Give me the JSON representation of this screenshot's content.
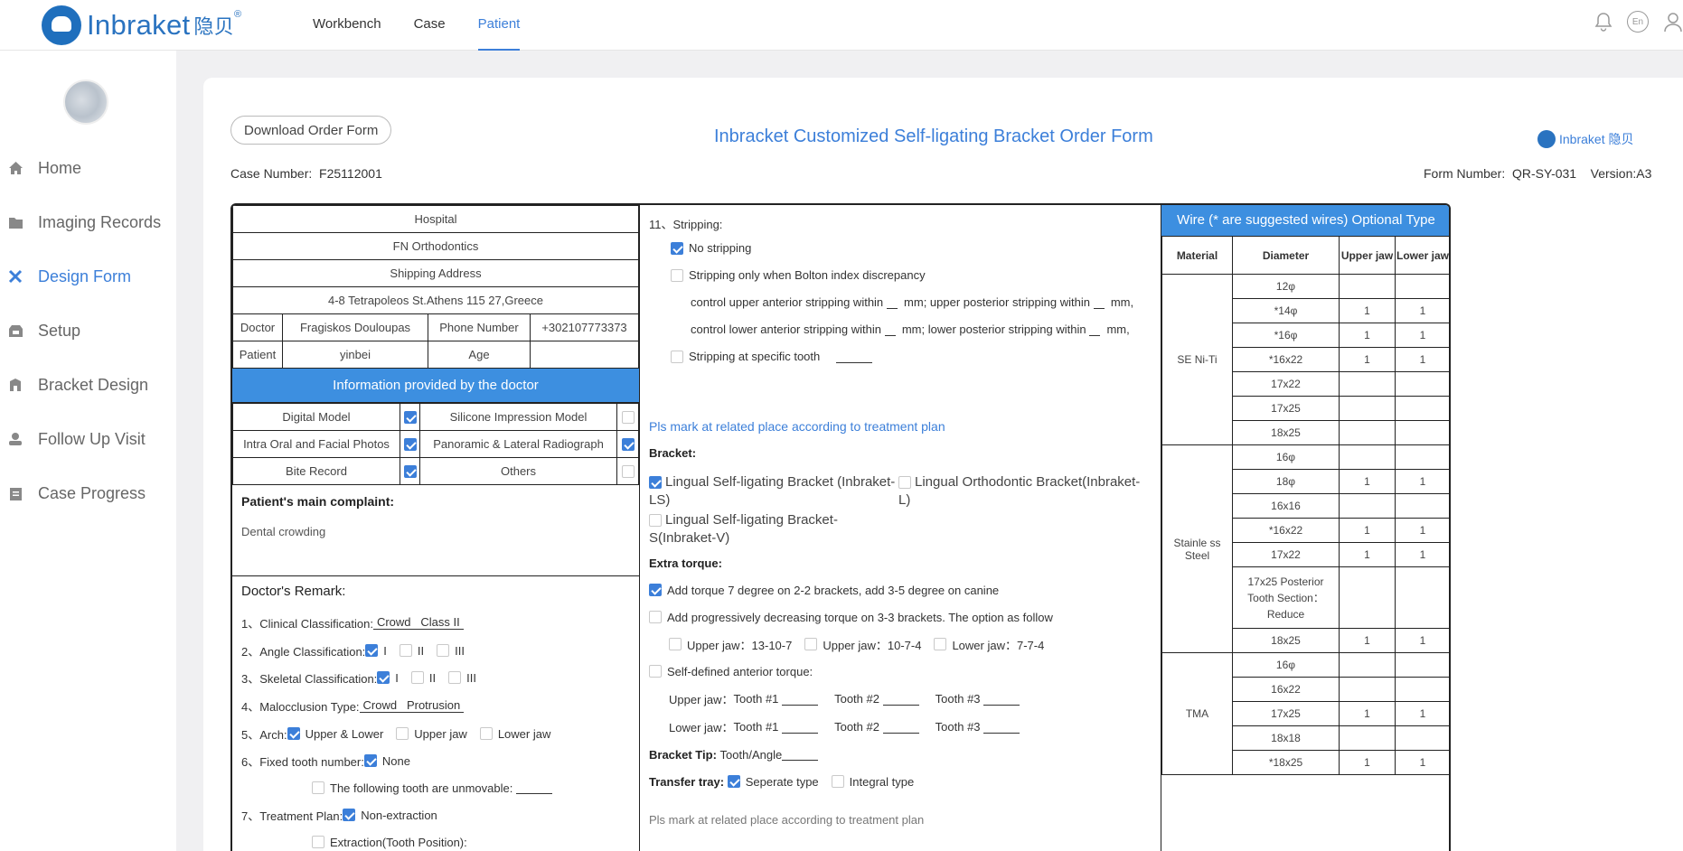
{
  "header": {
    "brand": "Inbraket",
    "brand_cn": "隐贝",
    "brand_reg": "®",
    "nav": [
      "Workbench",
      "Case",
      "Patient"
    ],
    "lang": "En"
  },
  "sidebar": {
    "items": [
      {
        "label": "Home",
        "icon": "home-icon"
      },
      {
        "label": "Imaging Records",
        "icon": "folder-icon"
      },
      {
        "label": "Design Form",
        "icon": "cross-icon"
      },
      {
        "label": "Setup",
        "icon": "setup-icon"
      },
      {
        "label": "Bracket Design",
        "icon": "building-icon"
      },
      {
        "label": "Follow Up Visit",
        "icon": "user-icon"
      },
      {
        "label": "Case Progress",
        "icon": "clipboard-icon"
      }
    ]
  },
  "page": {
    "download_btn": "Download Order Form",
    "title": "Inbracket Customized Self-ligating Bracket Order Form",
    "brand_small": "Inbraket 隐贝",
    "case_label": "Case Number:",
    "case_value": "F25112001",
    "form_label": "Form Number:",
    "form_value": "QR-SY-031",
    "version": "Version:A3"
  },
  "left": {
    "hospital_label": "Hospital",
    "hospital_value": "FN Orthodontics",
    "ship_label": "Shipping Address",
    "ship_value": "4-8 Tetrapoleos St.Athens 115 27,Greece",
    "doctor_label": "Doctor",
    "doctor_value": "Fragiskos Douloupas",
    "phone_label": "Phone Number",
    "phone_value": "+302107773373",
    "patient_label": "Patient",
    "patient_value": "yinbei",
    "age_label": "Age",
    "age_value": "",
    "info_head": "Information provided by the doctor",
    "info": [
      [
        "Digital Model",
        true,
        "Silicone Impression Model",
        false
      ],
      [
        "Intra Oral and Facial Photos",
        true,
        "Panoramic & Lateral Radiograph",
        true
      ],
      [
        "Bite Record",
        true,
        "Others",
        false
      ]
    ],
    "complaint_title": "Patient's main complaint:",
    "complaint_text": "Dental crowding",
    "remark_title": "Doctor's Remark:",
    "r1_label": "1、Clinical Classification:",
    "r1_value": "Crowd   Class II",
    "r2_label": "2、Angle Classification:",
    "r2_opts": [
      "I",
      "II",
      "III"
    ],
    "r3_label": "3、Skeletal Classification:",
    "r3_opts": [
      "I",
      "II",
      "III"
    ],
    "r4_label": "4、Malocclusion Type:",
    "r4_value": "Crowd   Protrusion",
    "r5_label": "5、Arch:",
    "r5_opts": [
      "Upper & Lower",
      "Upper jaw",
      "Lower jaw"
    ],
    "r6_label": "6、Fixed tooth number:",
    "r6_opt": "None",
    "r6_sub": "The following tooth are unmovable:",
    "r7_label": "7、Treatment Plan:",
    "r7_opt": "Non-extraction",
    "r7_sub": "Extraction(Tooth Position):"
  },
  "middle": {
    "s11": "11、Stripping:",
    "no_strip": "No stripping",
    "strip_bolton": "Stripping only when Bolton index discrepancy",
    "strip_upper_a": "control upper anterior stripping within",
    "strip_upper_b": "mm; upper posterior stripping within",
    "strip_upper_c": "mm,",
    "strip_lower_a": "control lower anterior stripping within",
    "strip_lower_b": "mm; lower posterior stripping within",
    "strip_lower_c": "mm,",
    "strip_specific": "Stripping at specific tooth",
    "mark_note": "Pls mark at related place according to treatment plan",
    "bracket_label": "Bracket:",
    "b1": "Lingual Self-ligating Bracket (Inbraket-LS)",
    "b2": "Lingual Orthodontic Bracket(Inbraket-L)",
    "b3": "Lingual Self-ligating Bracket-S(Inbraket-V)",
    "torque_label": "Extra torque:",
    "t1": "Add torque 7 degree on 2-2 brackets, add 3-5 degree on canine",
    "t2": "Add progressively decreasing torque on 3-3 brackets. The option as follow",
    "t2_opts": [
      "Upper jaw：13-10-7",
      "Upper jaw：10-7-4",
      "Lower jaw：7-7-4"
    ],
    "t3": "Self-defined anterior torque:",
    "upper_jaw": "Upper jaw：",
    "lower_jaw": "Lower jaw：",
    "tooth1": "Tooth #1",
    "tooth2": "Tooth #2",
    "tooth3": "Tooth #3",
    "tip_label": "Bracket Tip:",
    "tip_value": "Tooth/Angle",
    "tray_label": "Transfer tray:",
    "tray_opts": [
      "Seperate type",
      "Integral type"
    ],
    "bottom_note": "Pls mark at related place according to treatment plan"
  },
  "wire": {
    "head": "Wire (* are suggested wires) Optional Type",
    "cols": [
      "Material",
      "Diameter",
      "Upper jaw",
      "Lower jaw"
    ],
    "groups": [
      {
        "material": "SE Ni-Ti",
        "rows": [
          [
            "12φ",
            "",
            ""
          ],
          [
            "*14φ",
            "1",
            "1"
          ],
          [
            "*16φ",
            "1",
            "1"
          ],
          [
            "*16x22",
            "1",
            "1"
          ],
          [
            "17x22",
            "",
            ""
          ],
          [
            "17x25",
            "",
            ""
          ],
          [
            "18x25",
            "",
            ""
          ]
        ]
      },
      {
        "material": "Stainle ss Steel",
        "rows": [
          [
            "16φ",
            "",
            ""
          ],
          [
            "18φ",
            "1",
            "1"
          ],
          [
            "16x16",
            "",
            ""
          ],
          [
            "*16x22",
            "1",
            "1"
          ],
          [
            "17x22",
            "1",
            "1"
          ],
          [
            "17x25 Posterior Tooth Section：Reduce",
            "",
            ""
          ],
          [
            "18x25",
            "1",
            "1"
          ]
        ]
      },
      {
        "material": "TMA",
        "rows": [
          [
            "16φ",
            "",
            ""
          ],
          [
            "16x22",
            "",
            ""
          ],
          [
            "17x25",
            "1",
            "1"
          ],
          [
            "18x18",
            "",
            ""
          ],
          [
            "*18x25",
            "1",
            "1"
          ]
        ]
      }
    ]
  }
}
